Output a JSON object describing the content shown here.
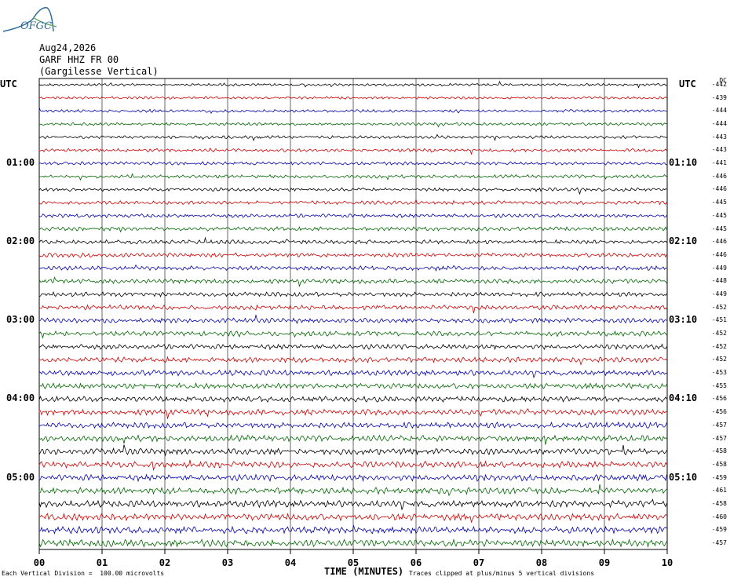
{
  "logo": {
    "text": "OFGC"
  },
  "header": {
    "date": "Aug24,2026",
    "station": "GARF HHZ FR 00",
    "site": "(Gargilesse Vertical)"
  },
  "utc_left": "UTC",
  "utc_right": "UTC",
  "dc_header": "DC",
  "left_hour_labels": [
    "01:00",
    "02:00",
    "03:00",
    "04:00",
    "05:00"
  ],
  "right_hour_labels": [
    "01:10",
    "02:10",
    "03:10",
    "04:10",
    "05:10"
  ],
  "x_ticks": [
    "00",
    "01",
    "02",
    "03",
    "04",
    "05",
    "06",
    "07",
    "08",
    "09",
    "10"
  ],
  "xlabel": "TIME (MINUTES)",
  "footer_left": "Each Vertical Division =  100.00 microvolts",
  "footer_right": "Traces clipped at plus/minus 5 vertical divisions",
  "colors": {
    "trace1": "#000000",
    "trace2": "#cc0000",
    "trace3": "#0000aa",
    "trace4": "#006600",
    "grid": "#000000",
    "logo": "#2a6a9a"
  },
  "chart_data": {
    "type": "line",
    "xlim": [
      0,
      10
    ],
    "trace_count": 36,
    "trace_colors": [
      "#000000",
      "#cc0000",
      "#0000aa",
      "#006600"
    ],
    "dc_offsets": [
      -442,
      -439,
      -444,
      -444,
      -443,
      -443,
      -441,
      -446,
      -446,
      -445,
      -445,
      -445,
      -446,
      -446,
      -449,
      -448,
      -449,
      -452,
      -451,
      -452,
      -452,
      -452,
      -453,
      -455,
      -456,
      -456,
      -457,
      -457,
      -458,
      -458,
      -459,
      -461,
      -458,
      -460,
      -459,
      -457
    ]
  }
}
